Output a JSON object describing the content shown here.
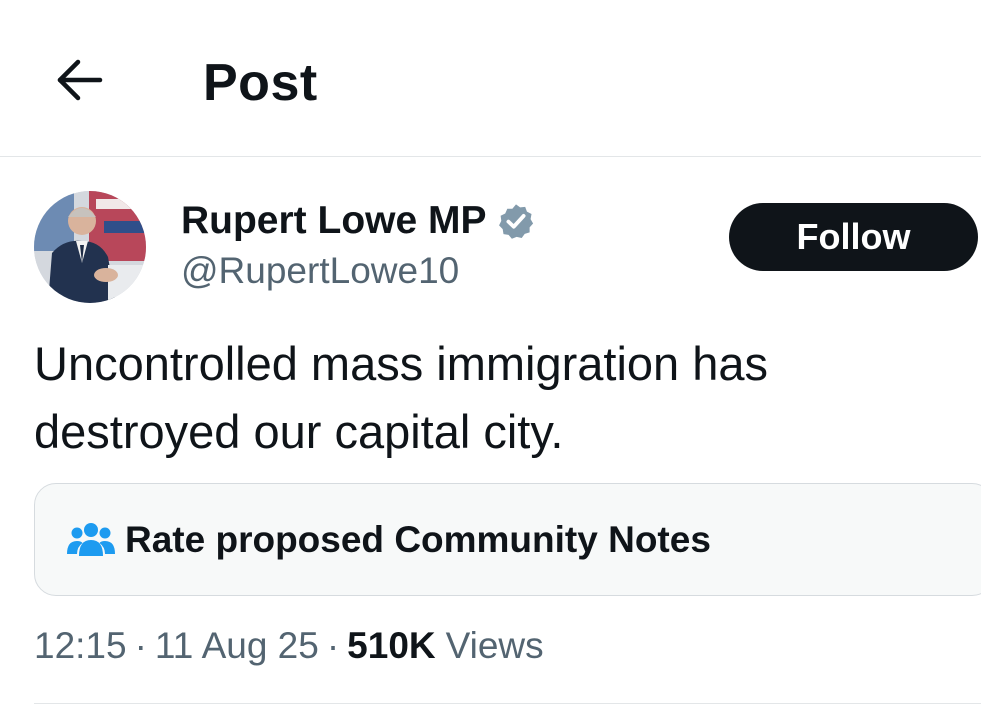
{
  "header": {
    "title": "Post",
    "back_icon": "arrow-left-icon"
  },
  "post": {
    "author": {
      "name": "Rupert Lowe MP",
      "handle": "@RupertLowe10",
      "verified": true,
      "verified_icon": "verified-badge-icon",
      "verified_color": "#829aab"
    },
    "follow_label": "Follow",
    "text": "Uncontrolled mass immigration has destroyed our capital city.",
    "community_notes": {
      "icon": "people-group-icon",
      "icon_color": "#1d9bf0",
      "label": "Rate proposed Community Notes"
    },
    "meta": {
      "time": "12:15",
      "date": "11 Aug 25",
      "views_count": "510K",
      "views_label": "Views",
      "separator": "·"
    }
  },
  "colors": {
    "text_primary": "#0f1419",
    "text_secondary": "#536471",
    "button_bg": "#0f1419",
    "divider": "#e3e6e8"
  }
}
